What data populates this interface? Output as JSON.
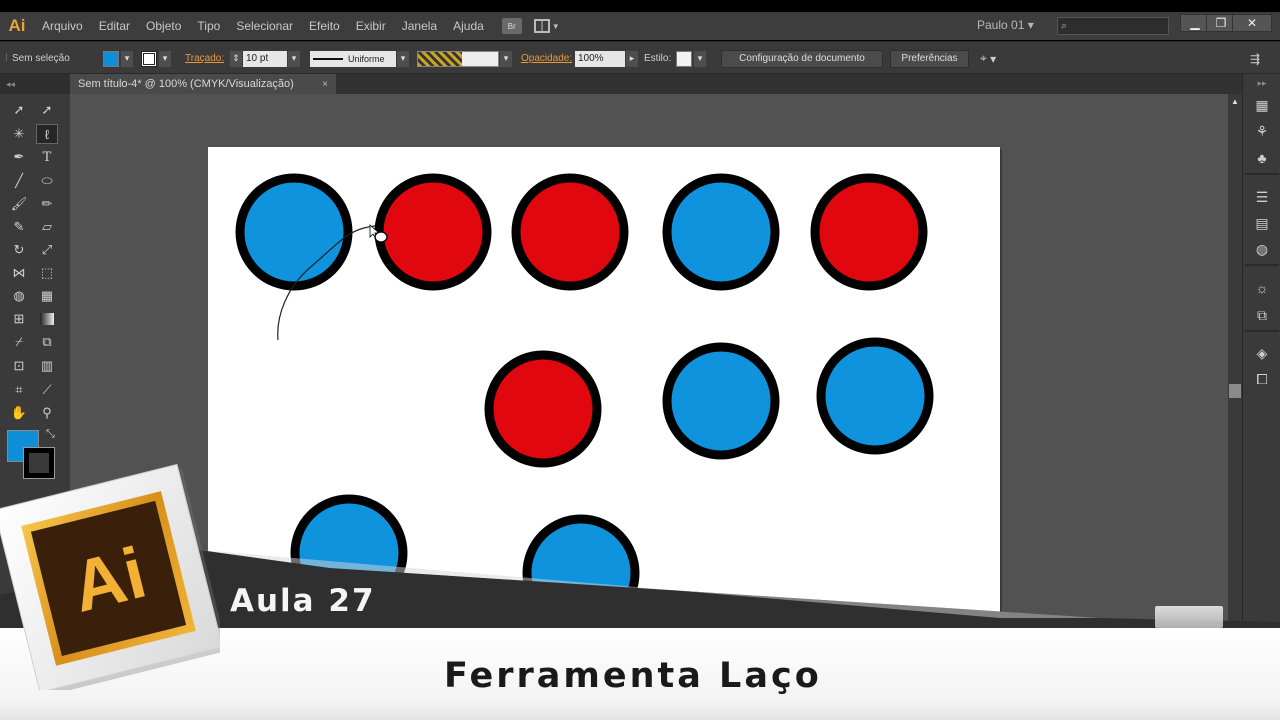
{
  "app": {
    "logo": "Ai",
    "menu": [
      "Arquivo",
      "Editar",
      "Objeto",
      "Tipo",
      "Selecionar",
      "Efeito",
      "Exibir",
      "Janela",
      "Ajuda"
    ],
    "bridge_label": "Br",
    "user": "Paulo 01",
    "search_icon": "search-icon",
    "window_buttons": [
      "minimize",
      "restore",
      "close"
    ]
  },
  "control_bar": {
    "selection_status": "Sem seleção",
    "fill_color": "#0e8fd8",
    "stroke_label": "Traçado:",
    "stroke_weight": "10 pt",
    "stroke_profile": "Uniforme",
    "opacity_label": "Opacidade:",
    "opacity_value": "100%",
    "style_label": "Estilo:",
    "doc_setup_button": "Configuração de documento",
    "preferences_button": "Preferências"
  },
  "document": {
    "tab_title": "Sem título-4* @ 100% (CMYK/Visualização)",
    "close_symbol": "×"
  },
  "artboard": {
    "colors": {
      "blue": "#0e93dc",
      "red": "#e0070f",
      "outline": "#000000"
    },
    "circles": [
      "blue",
      "red",
      "red",
      "blue",
      "red",
      "red",
      "blue",
      "blue",
      "blue",
      "blue"
    ]
  },
  "tools": {
    "fill_swatch": "#0e8fd8",
    "stroke_swatch": "#000000"
  },
  "overlay": {
    "lesson": "Aula 27",
    "title": "Ferramenta Laço",
    "logo_text": "Ai"
  }
}
